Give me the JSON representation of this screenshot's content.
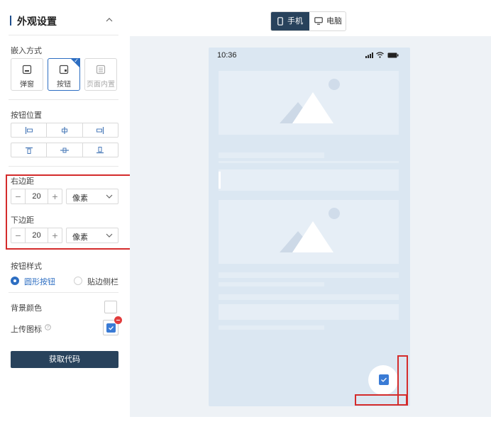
{
  "sidebar": {
    "title": "外观设置",
    "embed": {
      "label": "嵌入方式",
      "options": [
        "弹窗",
        "按钮",
        "页面内置"
      ],
      "selected": "按钮"
    },
    "position": {
      "label": "按钮位置",
      "icons": [
        "align-left-icon",
        "align-center-icon",
        "align-right-icon",
        "align-top-icon",
        "align-middle-icon",
        "align-bottom-icon"
      ]
    },
    "right_margin": {
      "label": "右边距",
      "value": "20",
      "unit": "像素"
    },
    "bottom_margin": {
      "label": "下边距",
      "value": "20",
      "unit": "像素"
    },
    "button_style": {
      "label": "按钮样式",
      "options": [
        "圆形按钮",
        "贴边侧栏"
      ],
      "selected": "圆形按钮"
    },
    "bg_color": {
      "label": "背景颜色"
    },
    "upload_icon": {
      "label": "上传图标"
    },
    "get_code": "获取代码"
  },
  "preview": {
    "toggle": {
      "mobile": "手机",
      "desktop": "电脑",
      "selected": "手机"
    },
    "phone": {
      "time": "10:36"
    }
  },
  "colors": {
    "accent": "#2d6ec2",
    "dark": "#28425c",
    "highlight": "#d42b2b"
  }
}
